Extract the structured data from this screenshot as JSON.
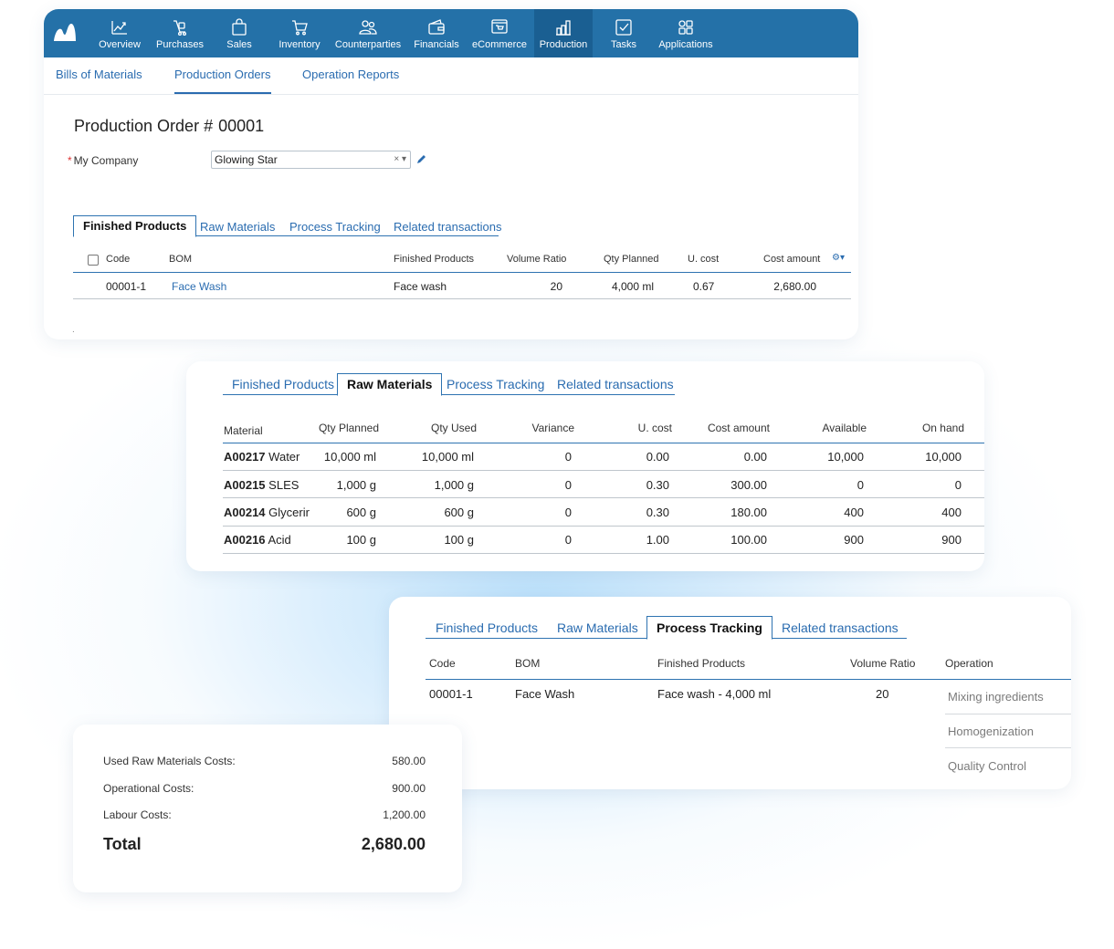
{
  "nav": {
    "items": [
      {
        "label": "Overview",
        "icon": "chart-line-icon"
      },
      {
        "label": "Purchases",
        "icon": "purchases-icon"
      },
      {
        "label": "Sales",
        "icon": "shopping-bag-icon"
      },
      {
        "label": "Inventory",
        "icon": "cart-icon"
      },
      {
        "label": "Counterparties",
        "icon": "people-icon"
      },
      {
        "label": "Financials",
        "icon": "wallet-icon"
      },
      {
        "label": "eCommerce",
        "icon": "ecommerce-icon"
      },
      {
        "label": "Production",
        "icon": "factory-icon"
      },
      {
        "label": "Tasks",
        "icon": "checkbox-icon"
      },
      {
        "label": "Applications",
        "icon": "apps-grid-icon"
      }
    ],
    "active": "Production"
  },
  "subtabs": [
    "Bills of Materials",
    "Production Orders",
    "Operation Reports"
  ],
  "order": {
    "title": "Production Order #",
    "number": "00001",
    "company_label": "My Company",
    "company_value": "Glowing Star",
    "select_controls": "× ▾"
  },
  "tabs": [
    "Finished Products",
    "Raw Materials",
    "Process Tracking",
    "Related transactions"
  ],
  "finished_products": {
    "headers": [
      "Code",
      "BOM",
      "Finished Products",
      "Volume Ratio",
      "Qty Planned",
      "U. cost",
      "Cost amount"
    ],
    "settings_glyph": "⚙▾",
    "rows": [
      {
        "code": "00001-1",
        "bom": "Face Wash",
        "product": "Face wash",
        "ratio": "20",
        "qty": "4,000 ml",
        "ucost": "0.67",
        "amount": "2,680.00"
      }
    ],
    "footer_mark": "."
  },
  "raw_materials": {
    "headers": [
      "Material",
      "Qty Planned",
      "Qty Used",
      "Variance",
      "U. cost",
      "Cost amount",
      "Available",
      "On hand"
    ],
    "rows": [
      {
        "code": "A00217",
        "name": "Water",
        "planned": "10,000 ml",
        "used": "10,000 ml",
        "variance": "0",
        "ucost": "0.00",
        "amount": "0.00",
        "available": "10,000",
        "onhand": "10,000"
      },
      {
        "code": "A00215",
        "name": "SLES",
        "planned": "1,000 g",
        "used": "1,000 g",
        "variance": "0",
        "ucost": "0.30",
        "amount": "300.00",
        "available": "0",
        "onhand": "0"
      },
      {
        "code": "A00214",
        "name": "Glycerir",
        "planned": "600 g",
        "used": "600 g",
        "variance": "0",
        "ucost": "0.30",
        "amount": "180.00",
        "available": "400",
        "onhand": "400"
      },
      {
        "code": "A00216",
        "name": "Acid",
        "planned": "100 g",
        "used": "100 g",
        "variance": "0",
        "ucost": "1.00",
        "amount": "100.00",
        "available": "900",
        "onhand": "900"
      }
    ]
  },
  "process_tracking": {
    "headers": [
      "Code",
      "BOM",
      "Finished Products",
      "Volume Ratio",
      "Operation"
    ],
    "row": {
      "code": "00001-1",
      "bom": "Face Wash",
      "product": "Face wash - 4,000 ml",
      "ratio": "20"
    },
    "operations": [
      "Mixing ingredients",
      "Homogenization",
      "Quality Control"
    ]
  },
  "costs": {
    "lines": [
      {
        "label": "Used Raw Materials Costs:",
        "value": "580.00"
      },
      {
        "label": "Operational Costs:",
        "value": "900.00"
      },
      {
        "label": "Labour Costs:",
        "value": "1,200.00"
      }
    ],
    "total_label": "Total",
    "total_value": "2,680.00"
  },
  "colors": {
    "nav_bg": "#2471a8",
    "nav_active": "#1a5f92",
    "link": "#2a6cb0",
    "accent_line": "#2e73b1"
  }
}
